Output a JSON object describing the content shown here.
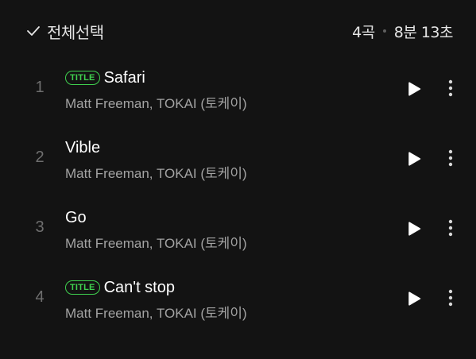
{
  "header": {
    "select_all_label": "전체선택",
    "check_icon": "check-icon",
    "track_count": "4곡",
    "total_duration": "8분 13초"
  },
  "tracks": [
    {
      "number": "1",
      "badge": "TITLE",
      "title": "Safari",
      "artist": "Matt Freeman, TOKAI (토케이)"
    },
    {
      "number": "2",
      "badge": "",
      "title": "Vible",
      "artist": "Matt Freeman, TOKAI (토케이)"
    },
    {
      "number": "3",
      "badge": "",
      "title": "Go",
      "artist": "Matt Freeman, TOKAI (토케이)"
    },
    {
      "number": "4",
      "badge": "TITLE",
      "title": "Can't stop",
      "artist": "Matt Freeman, TOKAI (토케이)"
    }
  ],
  "colors": {
    "background": "#131313",
    "accent_green": "#3fd14f",
    "text_primary": "#ffffff",
    "text_secondary": "#a3a3a3",
    "text_muted": "#6f6f6f"
  },
  "icons": {
    "play": "play-icon",
    "more": "more-vertical-icon"
  }
}
